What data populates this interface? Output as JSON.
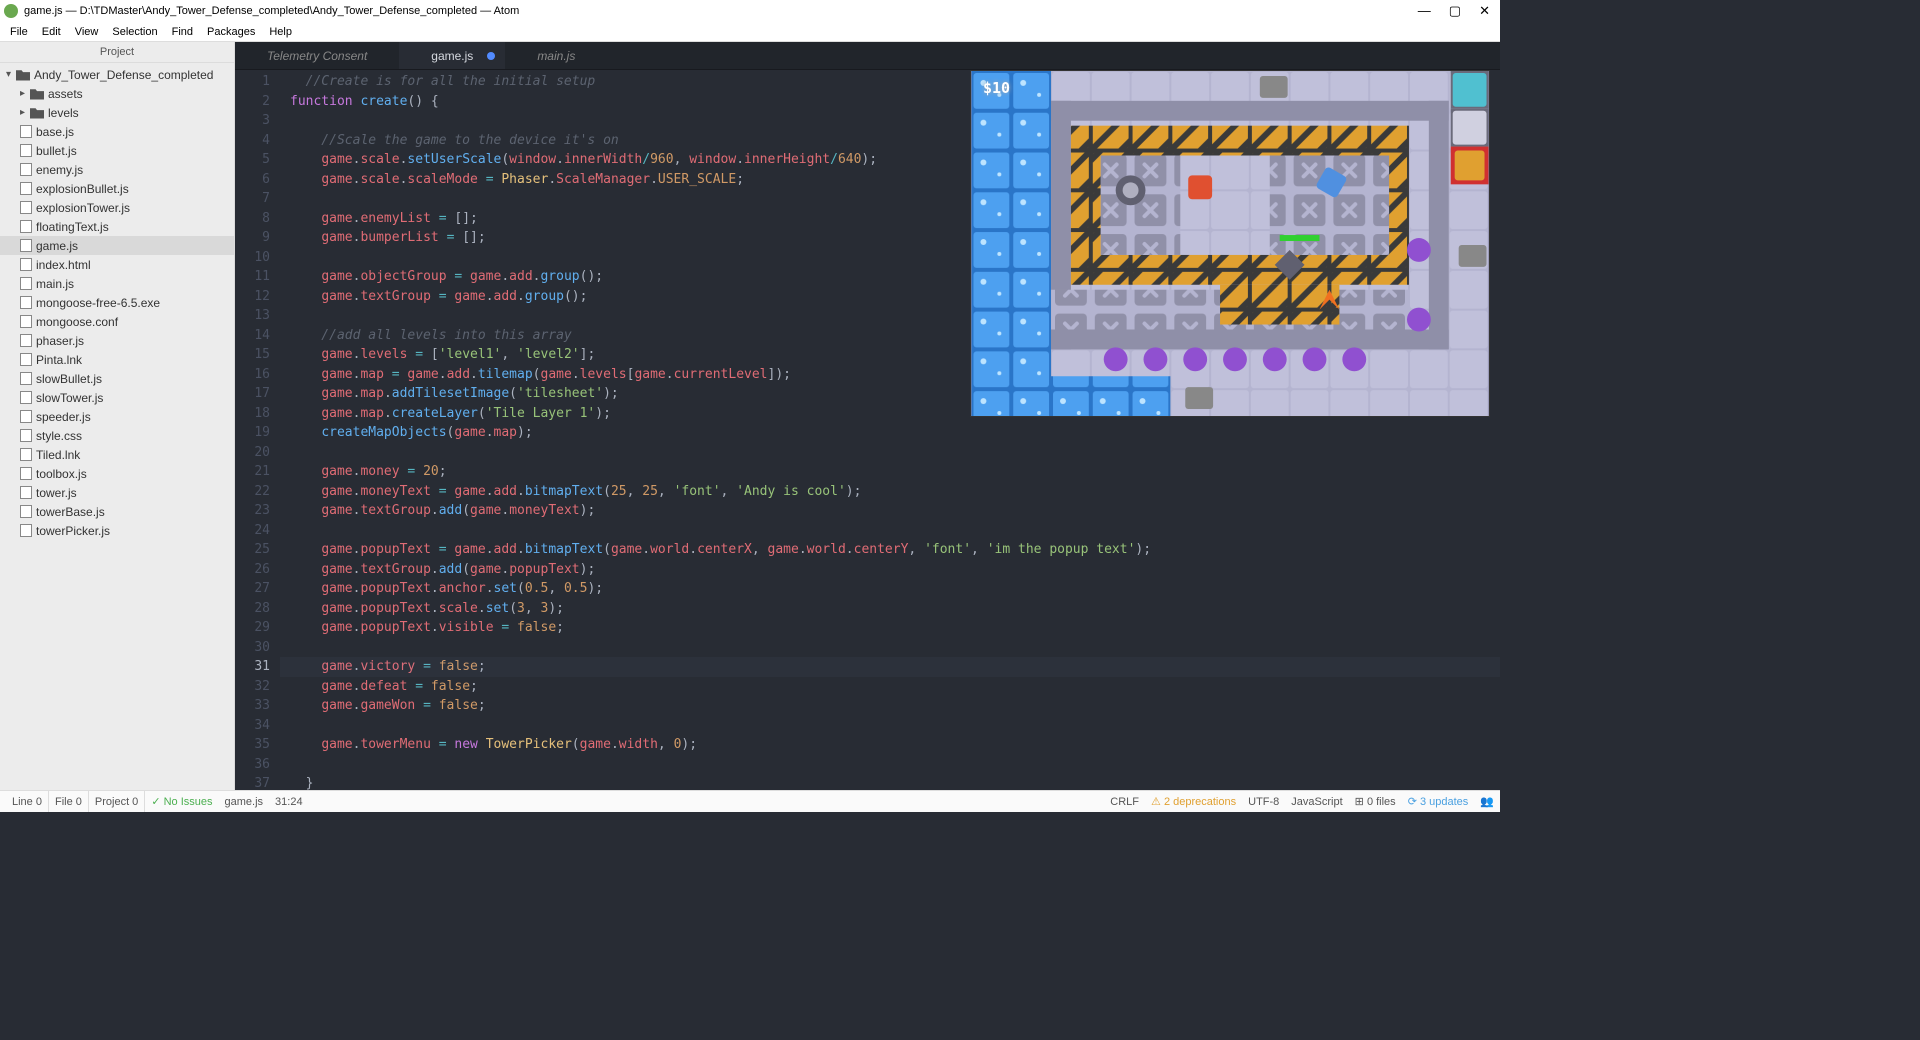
{
  "window": {
    "title": "game.js — D:\\TDMaster\\Andy_Tower_Defense_completed\\Andy_Tower_Defense_completed — Atom"
  },
  "menu": [
    "File",
    "Edit",
    "View",
    "Selection",
    "Find",
    "Packages",
    "Help"
  ],
  "sidebar": {
    "header": "Project",
    "root": "Andy_Tower_Defense_completed",
    "folders": [
      "assets",
      "levels"
    ],
    "files": [
      "base.js",
      "bullet.js",
      "enemy.js",
      "explosionBullet.js",
      "explosionTower.js",
      "floatingText.js",
      "game.js",
      "index.html",
      "main.js",
      "mongoose-free-6.5.exe",
      "mongoose.conf",
      "phaser.js",
      "Pinta.lnk",
      "slowBullet.js",
      "slowTower.js",
      "speeder.js",
      "style.css",
      "Tiled.lnk",
      "toolbox.js",
      "tower.js",
      "towerBase.js",
      "towerPicker.js"
    ],
    "selected": "game.js"
  },
  "tabs": [
    {
      "label": "Telemetry Consent",
      "active": false
    },
    {
      "label": "game.js",
      "active": true,
      "modified": true
    },
    {
      "label": "main.js",
      "active": false
    }
  ],
  "code": {
    "current_line": 31,
    "lines": [
      {
        "n": 1,
        "t": "comment",
        "s": "  //Create is for all the initial setup"
      },
      {
        "n": 2,
        "t": "raw",
        "s": "<span class='c-kw'>function</span> <span class='c-fn'>create</span>() {"
      },
      {
        "n": 3,
        "t": "blank",
        "s": ""
      },
      {
        "n": 4,
        "t": "comment",
        "s": "    //Scale the game to the device it's on"
      },
      {
        "n": 5,
        "t": "raw",
        "s": "    <span class='c-this'>game</span>.<span class='c-prop'>scale</span>.<span class='c-method'>setUserScale</span>(<span class='c-this'>window</span>.<span class='c-prop'>innerWidth</span><span class='c-op'>/</span><span class='c-num'>960</span>, <span class='c-this'>window</span>.<span class='c-prop'>innerHeight</span><span class='c-op'>/</span><span class='c-num'>640</span>);"
      },
      {
        "n": 6,
        "t": "raw",
        "s": "    <span class='c-this'>game</span>.<span class='c-prop'>scale</span>.<span class='c-prop'>scaleMode</span> <span class='c-op'>=</span> <span class='c-class'>Phaser</span>.<span class='c-prop'>ScaleManager</span>.<span class='c-const'>USER_SCALE</span>;"
      },
      {
        "n": 7,
        "t": "blank",
        "s": ""
      },
      {
        "n": 8,
        "t": "raw",
        "s": "    <span class='c-this'>game</span>.<span class='c-prop'>enemyList</span> <span class='c-op'>=</span> [];"
      },
      {
        "n": 9,
        "t": "raw",
        "s": "    <span class='c-this'>game</span>.<span class='c-prop'>bumperList</span> <span class='c-op'>=</span> [];"
      },
      {
        "n": 10,
        "t": "blank",
        "s": ""
      },
      {
        "n": 11,
        "t": "raw",
        "s": "    <span class='c-this'>game</span>.<span class='c-prop'>objectGroup</span> <span class='c-op'>=</span> <span class='c-this'>game</span>.<span class='c-prop'>add</span>.<span class='c-method'>group</span>();"
      },
      {
        "n": 12,
        "t": "raw",
        "s": "    <span class='c-this'>game</span>.<span class='c-prop'>textGroup</span> <span class='c-op'>=</span> <span class='c-this'>game</span>.<span class='c-prop'>add</span>.<span class='c-method'>group</span>();"
      },
      {
        "n": 13,
        "t": "blank",
        "s": ""
      },
      {
        "n": 14,
        "t": "comment",
        "s": "    //add all levels into this array"
      },
      {
        "n": 15,
        "t": "raw",
        "s": "    <span class='c-this'>game</span>.<span class='c-prop'>levels</span> <span class='c-op'>=</span> [<span class='c-str'>'level1'</span>, <span class='c-str'>'level2'</span>];"
      },
      {
        "n": 16,
        "t": "raw",
        "s": "    <span class='c-this'>game</span>.<span class='c-prop'>map</span> <span class='c-op'>=</span> <span class='c-this'>game</span>.<span class='c-prop'>add</span>.<span class='c-method'>tilemap</span>(<span class='c-this'>game</span>.<span class='c-prop'>levels</span>[<span class='c-this'>game</span>.<span class='c-prop'>currentLevel</span>]);"
      },
      {
        "n": 17,
        "t": "raw",
        "s": "    <span class='c-this'>game</span>.<span class='c-prop'>map</span>.<span class='c-method'>addTilesetImage</span>(<span class='c-str'>'tilesheet'</span>);"
      },
      {
        "n": 18,
        "t": "raw",
        "s": "    <span class='c-this'>game</span>.<span class='c-prop'>map</span>.<span class='c-method'>createLayer</span>(<span class='c-str'>'Tile Layer 1'</span>);"
      },
      {
        "n": 19,
        "t": "raw",
        "s": "    <span class='c-method'>createMapObjects</span>(<span class='c-this'>game</span>.<span class='c-prop'>map</span>);"
      },
      {
        "n": 20,
        "t": "blank",
        "s": ""
      },
      {
        "n": 21,
        "t": "raw",
        "s": "    <span class='c-this'>game</span>.<span class='c-prop'>money</span> <span class='c-op'>=</span> <span class='c-num'>20</span>;"
      },
      {
        "n": 22,
        "t": "raw",
        "s": "    <span class='c-this'>game</span>.<span class='c-prop'>moneyText</span> <span class='c-op'>=</span> <span class='c-this'>game</span>.<span class='c-prop'>add</span>.<span class='c-method'>bitmapText</span>(<span class='c-num'>25</span>, <span class='c-num'>25</span>, <span class='c-str'>'font'</span>, <span class='c-str'>'Andy is cool'</span>);"
      },
      {
        "n": 23,
        "t": "raw",
        "s": "    <span class='c-this'>game</span>.<span class='c-prop'>textGroup</span>.<span class='c-method'>add</span>(<span class='c-this'>game</span>.<span class='c-prop'>moneyText</span>);"
      },
      {
        "n": 24,
        "t": "blank",
        "s": ""
      },
      {
        "n": 25,
        "t": "raw",
        "s": "    <span class='c-this'>game</span>.<span class='c-prop'>popupText</span> <span class='c-op'>=</span> <span class='c-this'>game</span>.<span class='c-prop'>add</span>.<span class='c-method'>bitmapText</span>(<span class='c-this'>game</span>.<span class='c-prop'>world</span>.<span class='c-prop'>centerX</span>, <span class='c-this'>game</span>.<span class='c-prop'>world</span>.<span class='c-prop'>centerY</span>, <span class='c-str'>'font'</span>, <span class='c-str'>'im the popup text'</span>);"
      },
      {
        "n": 26,
        "t": "raw",
        "s": "    <span class='c-this'>game</span>.<span class='c-prop'>textGroup</span>.<span class='c-method'>add</span>(<span class='c-this'>game</span>.<span class='c-prop'>popupText</span>);"
      },
      {
        "n": 27,
        "t": "raw",
        "s": "    <span class='c-this'>game</span>.<span class='c-prop'>popupText</span>.<span class='c-prop'>anchor</span>.<span class='c-method'>set</span>(<span class='c-num'>0.5</span>, <span class='c-num'>0.5</span>);"
      },
      {
        "n": 28,
        "t": "raw",
        "s": "    <span class='c-this'>game</span>.<span class='c-prop'>popupText</span>.<span class='c-prop'>scale</span>.<span class='c-method'>set</span>(<span class='c-num'>3</span>, <span class='c-num'>3</span>);"
      },
      {
        "n": 29,
        "t": "raw",
        "s": "    <span class='c-this'>game</span>.<span class='c-prop'>popupText</span>.<span class='c-prop'>visible</span> <span class='c-op'>=</span> <span class='c-const'>false</span>;"
      },
      {
        "n": 30,
        "t": "blank",
        "s": ""
      },
      {
        "n": 31,
        "t": "raw",
        "s": "    <span class='c-this'>game</span>.<span class='c-prop'>victory</span> <span class='c-op'>=</span> <span class='c-const'>false</span>;"
      },
      {
        "n": 32,
        "t": "raw",
        "s": "    <span class='c-this'>game</span>.<span class='c-prop'>defeat</span> <span class='c-op'>=</span> <span class='c-const'>false</span>;"
      },
      {
        "n": 33,
        "t": "raw",
        "s": "    <span class='c-this'>game</span>.<span class='c-prop'>gameWon</span> <span class='c-op'>=</span> <span class='c-const'>false</span>;"
      },
      {
        "n": 34,
        "t": "blank",
        "s": ""
      },
      {
        "n": 35,
        "t": "raw",
        "s": "    <span class='c-this'>game</span>.<span class='c-prop'>towerMenu</span> <span class='c-op'>=</span> <span class='c-kw'>new</span> <span class='c-class'>TowerPicker</span>(<span class='c-this'>game</span>.<span class='c-prop'>width</span>, <span class='c-num'>0</span>);"
      },
      {
        "n": 36,
        "t": "blank",
        "s": ""
      },
      {
        "n": 37,
        "t": "raw",
        "s": "  }"
      }
    ]
  },
  "preview": {
    "money": "$10"
  },
  "status": {
    "line": "Line  0",
    "file": "File  0",
    "project": "Project  0",
    "issues": "✓ No Issues",
    "filename": "game.js",
    "cursor": "31:24",
    "eol": "CRLF",
    "deprecations": "2 deprecations",
    "encoding": "UTF-8",
    "language": "JavaScript",
    "git_files": "0 files",
    "updates": "3 updates"
  }
}
